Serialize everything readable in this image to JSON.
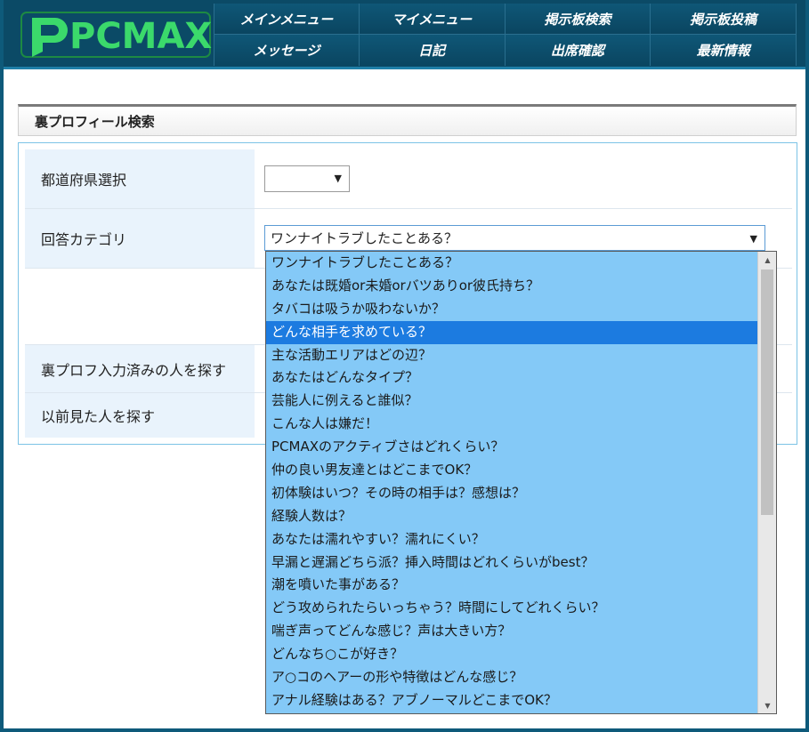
{
  "brand": {
    "logo_text": "PCMAX"
  },
  "nav": {
    "items": [
      {
        "label": "メインメニュー"
      },
      {
        "label": "マイメニュー"
      },
      {
        "label": "掲示板検索"
      },
      {
        "label": "掲示板投稿"
      },
      {
        "label": "メッセージ"
      },
      {
        "label": "日記"
      },
      {
        "label": "出席確認"
      },
      {
        "label": "最新情報"
      }
    ]
  },
  "page": {
    "title": "裏プロフィール検索"
  },
  "form": {
    "rows": [
      {
        "label": "都道府県選択"
      },
      {
        "label": "回答カテゴリ"
      },
      {
        "label": ""
      },
      {
        "label": "裏プロフ入力済みの人を探す"
      },
      {
        "label": "以前見た人を探す"
      }
    ],
    "prefecture_select": {
      "value": ""
    },
    "category_select": {
      "value": "ワンナイトラブしたことある？",
      "options": [
        "ワンナイトラブしたことある？",
        "あなたは既婚or未婚orバツありor彼氏持ち？",
        "タバコは吸うか吸わないか？",
        "どんな相手を求めている？",
        "主な活動エリアはどの辺？",
        "あなたはどんなタイプ？",
        "芸能人に例えると誰似？",
        "こんな人は嫌だ！",
        "PCMAXのアクティブさはどれくらい？",
        "仲の良い男友達とはどこまでOK？",
        "初体験はいつ？その時の相手は？感想は？",
        "経験人数は？",
        "あなたは濡れやすい？濡れにくい？",
        "早漏と遅漏どちら派？挿入時間はどれくらいがbest？",
        "潮を噴いた事がある？",
        "どう攻められたらいっちゃう？時間にしてどれくらい？",
        "喘ぎ声ってどんな感じ？声は大きい方？",
        "どんなち○こが好き？",
        "ア○コのヘアーの形や特徴はどんな感じ？",
        "アナル経験はある？アブノーマルどこまでOK？"
      ],
      "highlighted_index": 3
    }
  },
  "icons": {
    "dropdown_arrow": "▼",
    "scroll_up": "▲",
    "scroll_down": "▼"
  },
  "colors": {
    "header_bg": "#0b4a66",
    "logo_green": "#3bd96b",
    "dropdown_bg": "#84c9f7",
    "highlight": "#1c7be0",
    "label_bg": "#e9f3fc",
    "form_border": "#7cc3e6"
  }
}
